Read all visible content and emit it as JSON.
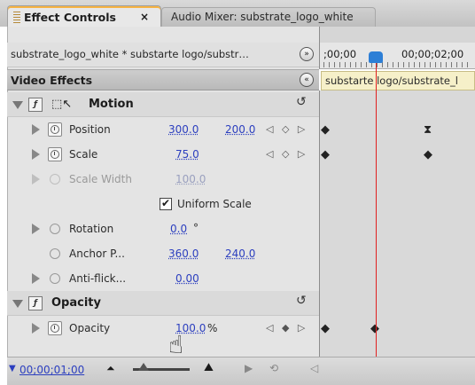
{
  "tabs": {
    "active_label": "Effect Controls",
    "active_close": "×",
    "inactive_label": "Audio Mixer: substrate_logo_white"
  },
  "clip_header": {
    "name": "substrate_logo_white * substarte logo/substr…",
    "expand_glyph": "»"
  },
  "timeline": {
    "time_start": ";00;00",
    "time_mark": "00;00;02;00",
    "clip_label": "substarte logo/substrate_l"
  },
  "video_effects": {
    "title": "Video Effects",
    "collapse_glyph": "«",
    "motion": {
      "label": "Motion",
      "position": {
        "label": "Position",
        "x": "300.0",
        "y": "200.0"
      },
      "scale": {
        "label": "Scale",
        "value": "75.0"
      },
      "scale_width": {
        "label": "Scale Width",
        "value": "100.0"
      },
      "uniform_scale": {
        "label": "Uniform Scale",
        "checked": true
      },
      "rotation": {
        "label": "Rotation",
        "value": "0.0",
        "unit": "°"
      },
      "anchor": {
        "label": "Anchor P...",
        "x": "360.0",
        "y": "240.0"
      },
      "antiflicker": {
        "label": "Anti-flick...",
        "value": "0.00"
      }
    },
    "opacity": {
      "label": "Opacity",
      "prop": {
        "label": "Opacity",
        "value": "100.0",
        "unit": "%"
      }
    }
  },
  "bottom": {
    "timecode": "00;00;01;00"
  },
  "colors": {
    "accent": "#f6b342",
    "value_blue": "#2c3fbf",
    "playhead": "#e02020",
    "clip_bar": "#f6f0c9"
  }
}
